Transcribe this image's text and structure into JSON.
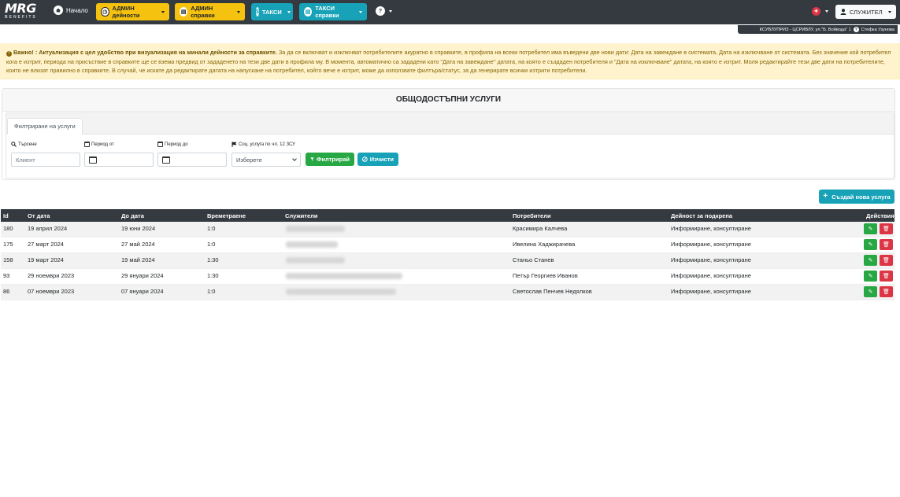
{
  "navbar": {
    "logo_text": "MRG",
    "logo_subtext": "BENEFITS",
    "home_label": "Начало",
    "menu": [
      {
        "label": "АДМИН дейности",
        "icon": "clock-icon",
        "variant": "yellow"
      },
      {
        "label": "АДМИН справки",
        "icon": "document-icon",
        "variant": "yellow"
      },
      {
        "label": "ТАКСИ",
        "icon": "dollar-icon",
        "variant": "cyan"
      },
      {
        "label": "ТАКСИ справки",
        "icon": "document-icon",
        "variant": "cyan"
      }
    ],
    "help_icon": "?",
    "user_label": "СЛУЖИТЕЛ"
  },
  "infobar": {
    "location": "КСУВЛУПРИЗ - ЦСРИВЛУ, ул.\"Б. Войвода\" 1",
    "user_name": "Стефка Узунова"
  },
  "alert": {
    "bold_text": "Важно! : Актуализация с цел удобство при визуализация на минали дейности за справките.",
    "text": "За да се включват и изключват потребителите акуратно в справките, в профила на всеки потребител има въведени две нови дати: Дата на завеждане в системата, Дата на изключване от системата. Без значение кой потребител кога е изтрит, периода на присъствие в справките ще се взема предвид от зададенето на тези две дати в профила му. В момента, автоматично са зададени като \"Дата на завеждане\" датата, на която е създаден потребителя и \"Дата на изключване\" датата, на която е изтрит. Моля редактирайте тези две дати на потребителите, които не влизат правилно в справките. В случай, че искате да редактирате датата на напускане на потребител, който вече е изтрит, може да използвате филтъра/статус, за да генерирате всички изтрити потребители."
  },
  "page_title": "ОБЩОДОСТЪПНИ УСЛУГИ",
  "filter": {
    "tab_label": "Филтриране на услуги",
    "search_label": "Търсене",
    "search_placeholder": "Клиент",
    "period_from_label": "Период от",
    "period_to_label": "Период до",
    "social_label": "Соц. услуга по чл. 12 ЗСУ",
    "select_value": "Изберете",
    "filter_button": "Филтрирай",
    "clear_button": "Изчисти"
  },
  "create_button": "Създай нова услуга",
  "table": {
    "columns": [
      "Id",
      "От дата",
      "До дата",
      "Времетраене",
      "Служители",
      "Потребители",
      "Дейност за подкрепа",
      "Действия"
    ],
    "rows": [
      {
        "id": "180",
        "from": "19 април 2024",
        "to": "19 юни 2024",
        "duration": "1:0",
        "client": "Красимира Калчева",
        "activity": "Информиране, консултиране"
      },
      {
        "id": "175",
        "from": "27 март 2024",
        "to": "27 май 2024",
        "duration": "1:0",
        "client": "Ивелина Хаджирачева",
        "activity": "Информиране, консултиране"
      },
      {
        "id": "158",
        "from": "19 март 2024",
        "to": "19 май 2024",
        "duration": "1:30",
        "client": "Станьо Станев",
        "activity": "Информиране, консултиране"
      },
      {
        "id": "93",
        "from": "29 ноември 2023",
        "to": "29 януари 2024",
        "duration": "1:30",
        "client": "Петър Георгиев Иванов",
        "activity": "Информиране, консултиране"
      },
      {
        "id": "86",
        "from": "07 ноември 2023",
        "to": "07 януари 2024",
        "duration": "1:0",
        "client": "Светослав Пенчев Недялков",
        "activity": "Информиране, консултиране"
      }
    ]
  },
  "colors": {
    "navbar": "#343a40",
    "yellow": "#f4c20f",
    "cyan": "#17a2b8",
    "green": "#28a745",
    "red": "#dc3545",
    "alert_bg": "#fff3cd"
  }
}
